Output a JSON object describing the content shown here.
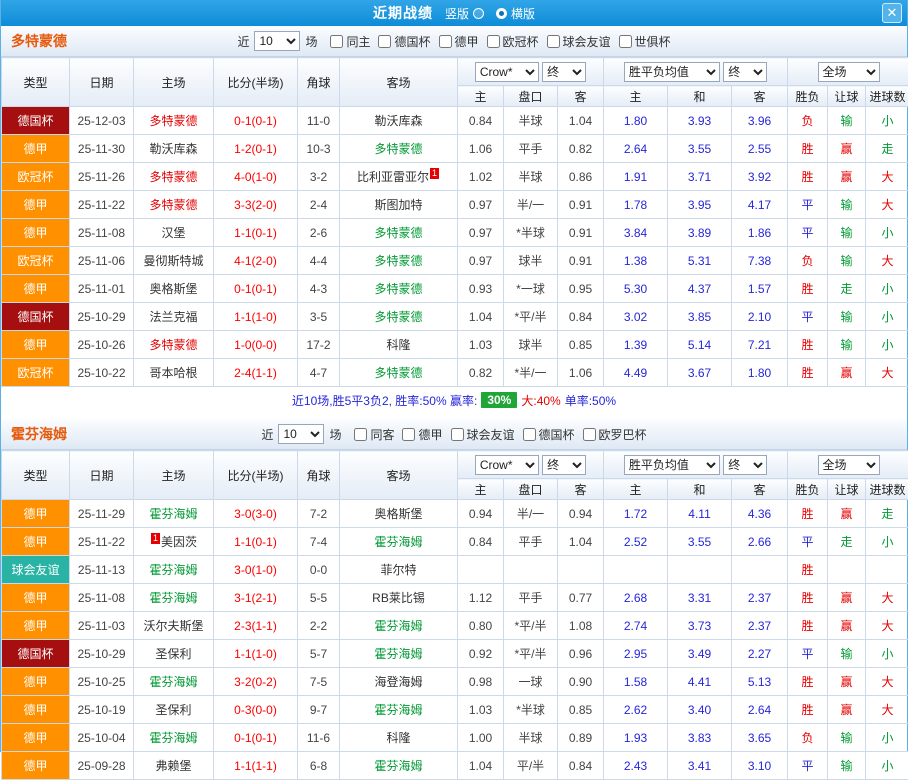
{
  "topbar": {
    "title": "近期战绩",
    "opt_vertical": "竖版",
    "opt_horizontal": "横版",
    "close": "✕"
  },
  "colors": {
    "topbar_blue": "#1296db",
    "team_name_orange": "#e8590c",
    "type_dfb_pokal": "#a50f0f",
    "type_bundesliga": "#ff9000",
    "type_ucl": "#ff9000",
    "type_friendly": "#29b3a5",
    "score_red": "#ff0000",
    "home_focus_red": "#e60000",
    "away_focus_green": "#009933",
    "euro_odds_blue": "#2626d9",
    "badge_green": "#1fa637"
  },
  "sections": [
    {
      "team": "多特蒙德",
      "near": "近",
      "count": "10",
      "games": "场",
      "filters": [
        "同主",
        "德国杯",
        "德甲",
        "欧冠杯",
        "球会友谊",
        "世俱杯"
      ],
      "header": {
        "c_type": "类型",
        "c_date": "日期",
        "c_home": "主场",
        "c_score": "比分(半场)",
        "c_corner": "角球",
        "c_away": "客场",
        "sel_company": "Crow*",
        "sel_final1": "终",
        "sel_euro": "胜平负均值",
        "sel_final2": "终",
        "sel_full": "全场",
        "sub": [
          "主",
          "盘口",
          "客",
          "主",
          "和",
          "客",
          "胜负",
          "让球",
          "进球数"
        ]
      },
      "rows": [
        {
          "type": "德国杯",
          "tc": "dfb",
          "date": "25-12-03",
          "home": "多特蒙德",
          "hc": "r",
          "score": "0-1(0-1)",
          "corner": "11-0",
          "away": "勒沃库森",
          "ac": "k",
          "o1": "0.84",
          "hcp": "半球",
          "o2": "1.04",
          "e1": "1.80",
          "e2": "3.93",
          "e3": "3.96",
          "r1": "负",
          "r1c": "r",
          "r2": "输",
          "r2c": "g",
          "r3": "小",
          "r3c": "g"
        },
        {
          "type": "德甲",
          "tc": "bun",
          "date": "25-11-30",
          "home": "勒沃库森",
          "hc": "k",
          "score": "1-2(0-1)",
          "corner": "10-3",
          "away": "多特蒙德",
          "ac": "g",
          "o1": "1.06",
          "hcp": "平手",
          "o2": "0.82",
          "e1": "2.64",
          "e2": "3.55",
          "e3": "2.55",
          "r1": "胜",
          "r1c": "r",
          "r2": "赢",
          "r2c": "r",
          "r3": "走",
          "r3c": "g"
        },
        {
          "type": "欧冠杯",
          "tc": "ucl",
          "date": "25-11-26",
          "home": "多特蒙德",
          "hc": "r",
          "score": "4-0(1-0)",
          "corner": "3-2",
          "away": "比利亚雷亚尔",
          "ac": "k",
          "ab": "1",
          "abp": "post",
          "o1": "1.02",
          "hcp": "半球",
          "o2": "0.86",
          "e1": "1.91",
          "e2": "3.71",
          "e3": "3.92",
          "r1": "胜",
          "r1c": "r",
          "r2": "赢",
          "r2c": "r",
          "r3": "大",
          "r3c": "r"
        },
        {
          "type": "德甲",
          "tc": "bun",
          "date": "25-11-22",
          "home": "多特蒙德",
          "hc": "r",
          "score": "3-3(2-0)",
          "corner": "2-4",
          "away": "斯图加特",
          "ac": "k",
          "o1": "0.97",
          "hcp": "半/一",
          "o2": "0.91",
          "e1": "1.78",
          "e2": "3.95",
          "e3": "4.17",
          "r1": "平",
          "r1c": "b",
          "r2": "输",
          "r2c": "g",
          "r3": "大",
          "r3c": "r"
        },
        {
          "type": "德甲",
          "tc": "bun",
          "date": "25-11-08",
          "home": "汉堡",
          "hc": "k",
          "score": "1-1(0-1)",
          "corner": "2-6",
          "away": "多特蒙德",
          "ac": "g",
          "o1": "0.97",
          "hcp": "*半球",
          "o2": "0.91",
          "e1": "3.84",
          "e2": "3.89",
          "e3": "1.86",
          "r1": "平",
          "r1c": "b",
          "r2": "输",
          "r2c": "g",
          "r3": "小",
          "r3c": "g"
        },
        {
          "type": "欧冠杯",
          "tc": "ucl",
          "date": "25-11-06",
          "home": "曼彻斯特城",
          "hc": "k",
          "score": "4-1(2-0)",
          "corner": "4-4",
          "away": "多特蒙德",
          "ac": "g",
          "o1": "0.97",
          "hcp": "球半",
          "o2": "0.91",
          "e1": "1.38",
          "e2": "5.31",
          "e3": "7.38",
          "r1": "负",
          "r1c": "r",
          "r2": "输",
          "r2c": "g",
          "r3": "大",
          "r3c": "r"
        },
        {
          "type": "德甲",
          "tc": "bun",
          "date": "25-11-01",
          "home": "奥格斯堡",
          "hc": "k",
          "score": "0-1(0-1)",
          "corner": "4-3",
          "away": "多特蒙德",
          "ac": "g",
          "o1": "0.93",
          "hcp": "*一球",
          "o2": "0.95",
          "e1": "5.30",
          "e2": "4.37",
          "e3": "1.57",
          "r1": "胜",
          "r1c": "r",
          "r2": "走",
          "r2c": "g",
          "r3": "小",
          "r3c": "g"
        },
        {
          "type": "德国杯",
          "tc": "dfb",
          "date": "25-10-29",
          "home": "法兰克福",
          "hc": "k",
          "score": "1-1(1-0)",
          "corner": "3-5",
          "away": "多特蒙德",
          "ac": "g",
          "o1": "1.04",
          "hcp": "*平/半",
          "o2": "0.84",
          "e1": "3.02",
          "e2": "3.85",
          "e3": "2.10",
          "r1": "平",
          "r1c": "b",
          "r2": "输",
          "r2c": "g",
          "r3": "小",
          "r3c": "g"
        },
        {
          "type": "德甲",
          "tc": "bun",
          "date": "25-10-26",
          "home": "多特蒙德",
          "hc": "r",
          "score": "1-0(0-0)",
          "corner": "17-2",
          "away": "科隆",
          "ac": "k",
          "o1": "1.03",
          "hcp": "球半",
          "o2": "0.85",
          "e1": "1.39",
          "e2": "5.14",
          "e3": "7.21",
          "r1": "胜",
          "r1c": "r",
          "r2": "输",
          "r2c": "g",
          "r3": "小",
          "r3c": "g"
        },
        {
          "type": "欧冠杯",
          "tc": "ucl",
          "date": "25-10-22",
          "home": "哥本哈根",
          "hc": "k",
          "score": "2-4(1-1)",
          "corner": "4-7",
          "away": "多特蒙德",
          "ac": "g",
          "o1": "0.82",
          "hcp": "*半/一",
          "o2": "1.06",
          "e1": "4.49",
          "e2": "3.67",
          "e3": "1.80",
          "r1": "胜",
          "r1c": "r",
          "r2": "赢",
          "r2c": "r",
          "r3": "大",
          "r3c": "r"
        }
      ],
      "summary": [
        {
          "t": "近10场,胜5平3负2, 胜率:50% 赢率:",
          "cls": "bl"
        },
        {
          "t": "30%",
          "cls": "badge"
        },
        {
          "t": "大:40%",
          "cls": "rd"
        },
        {
          "t": "单率:50%",
          "cls": "bl"
        }
      ]
    },
    {
      "team": "霍芬海姆",
      "near": "近",
      "count": "10",
      "games": "场",
      "filters": [
        "同客",
        "德甲",
        "球会友谊",
        "德国杯",
        "欧罗巴杯"
      ],
      "header": {
        "c_type": "类型",
        "c_date": "日期",
        "c_home": "主场",
        "c_score": "比分(半场)",
        "c_corner": "角球",
        "c_away": "客场",
        "sel_company": "Crow*",
        "sel_final1": "终",
        "sel_euro": "胜平负均值",
        "sel_final2": "终",
        "sel_full": "全场",
        "sub": [
          "主",
          "盘口",
          "客",
          "主",
          "和",
          "客",
          "胜负",
          "让球",
          "进球数"
        ]
      },
      "rows": [
        {
          "type": "德甲",
          "tc": "bun",
          "date": "25-11-29",
          "home": "霍芬海姆",
          "hc": "g",
          "score": "3-0(3-0)",
          "corner": "7-2",
          "away": "奥格斯堡",
          "ac": "k",
          "o1": "0.94",
          "hcp": "半/一",
          "o2": "0.94",
          "e1": "1.72",
          "e2": "4.11",
          "e3": "4.36",
          "r1": "胜",
          "r1c": "r",
          "r2": "赢",
          "r2c": "r",
          "r3": "走",
          "r3c": "g"
        },
        {
          "type": "德甲",
          "tc": "bun",
          "date": "25-11-22",
          "home": "美因茨",
          "hc": "k",
          "hb": "1",
          "hbp": "pre",
          "score": "1-1(0-1)",
          "corner": "7-4",
          "away": "霍芬海姆",
          "ac": "g",
          "o1": "0.84",
          "hcp": "平手",
          "o2": "1.04",
          "e1": "2.52",
          "e2": "3.55",
          "e3": "2.66",
          "r1": "平",
          "r1c": "b",
          "r2": "走",
          "r2c": "g",
          "r3": "小",
          "r3c": "g"
        },
        {
          "type": "球会友谊",
          "tc": "fri",
          "date": "25-11-13",
          "home": "霍芬海姆",
          "hc": "g",
          "score": "3-0(1-0)",
          "corner": "0-0",
          "away": "菲尔特",
          "ac": "k",
          "o1": "",
          "hcp": "",
          "o2": "",
          "e1": "",
          "e2": "",
          "e3": "",
          "r1": "胜",
          "r1c": "r",
          "r2": "",
          "r2c": "",
          "r3": "",
          "r3c": ""
        },
        {
          "type": "德甲",
          "tc": "bun",
          "date": "25-11-08",
          "home": "霍芬海姆",
          "hc": "g",
          "score": "3-1(2-1)",
          "corner": "5-5",
          "away": "RB莱比锡",
          "ac": "k",
          "o1": "1.12",
          "hcp": "平手",
          "o2": "0.77",
          "e1": "2.68",
          "e2": "3.31",
          "e3": "2.37",
          "r1": "胜",
          "r1c": "r",
          "r2": "赢",
          "r2c": "r",
          "r3": "大",
          "r3c": "r"
        },
        {
          "type": "德甲",
          "tc": "bun",
          "date": "25-11-03",
          "home": "沃尔夫斯堡",
          "hc": "k",
          "score": "2-3(1-1)",
          "corner": "2-2",
          "away": "霍芬海姆",
          "ac": "g",
          "o1": "0.80",
          "hcp": "*平/半",
          "o2": "1.08",
          "e1": "2.74",
          "e2": "3.73",
          "e3": "2.37",
          "r1": "胜",
          "r1c": "r",
          "r2": "赢",
          "r2c": "r",
          "r3": "大",
          "r3c": "r"
        },
        {
          "type": "德国杯",
          "tc": "dfb",
          "date": "25-10-29",
          "home": "圣保利",
          "hc": "k",
          "score": "1-1(1-0)",
          "corner": "5-7",
          "away": "霍芬海姆",
          "ac": "g",
          "o1": "0.92",
          "hcp": "*平/半",
          "o2": "0.96",
          "e1": "2.95",
          "e2": "3.49",
          "e3": "2.27",
          "r1": "平",
          "r1c": "b",
          "r2": "输",
          "r2c": "g",
          "r3": "小",
          "r3c": "g"
        },
        {
          "type": "德甲",
          "tc": "bun",
          "date": "25-10-25",
          "home": "霍芬海姆",
          "hc": "g",
          "score": "3-2(0-2)",
          "corner": "7-5",
          "away": "海登海姆",
          "ac": "k",
          "o1": "0.98",
          "hcp": "一球",
          "o2": "0.90",
          "e1": "1.58",
          "e2": "4.41",
          "e3": "5.13",
          "r1": "胜",
          "r1c": "r",
          "r2": "赢",
          "r2c": "r",
          "r3": "大",
          "r3c": "r"
        },
        {
          "type": "德甲",
          "tc": "bun",
          "date": "25-10-19",
          "home": "圣保利",
          "hc": "k",
          "score": "0-3(0-0)",
          "corner": "9-7",
          "away": "霍芬海姆",
          "ac": "g",
          "o1": "1.03",
          "hcp": "*半球",
          "o2": "0.85",
          "e1": "2.62",
          "e2": "3.40",
          "e3": "2.64",
          "r1": "胜",
          "r1c": "r",
          "r2": "赢",
          "r2c": "r",
          "r3": "大",
          "r3c": "r"
        },
        {
          "type": "德甲",
          "tc": "bun",
          "date": "25-10-04",
          "home": "霍芬海姆",
          "hc": "g",
          "score": "0-1(0-1)",
          "corner": "11-6",
          "away": "科隆",
          "ac": "k",
          "o1": "1.00",
          "hcp": "半球",
          "o2": "0.89",
          "e1": "1.93",
          "e2": "3.83",
          "e3": "3.65",
          "r1": "负",
          "r1c": "r",
          "r2": "输",
          "r2c": "g",
          "r3": "小",
          "r3c": "g"
        },
        {
          "type": "德甲",
          "tc": "bun",
          "date": "25-09-28",
          "home": "弗赖堡",
          "hc": "k",
          "score": "1-1(1-1)",
          "corner": "6-8",
          "away": "霍芬海姆",
          "ac": "g",
          "o1": "1.04",
          "hcp": "平/半",
          "o2": "0.84",
          "e1": "2.43",
          "e2": "3.41",
          "e3": "3.10",
          "r1": "平",
          "r1c": "b",
          "r2": "输",
          "r2c": "g",
          "r3": "小",
          "r3c": "g"
        }
      ],
      "summary": null
    }
  ]
}
